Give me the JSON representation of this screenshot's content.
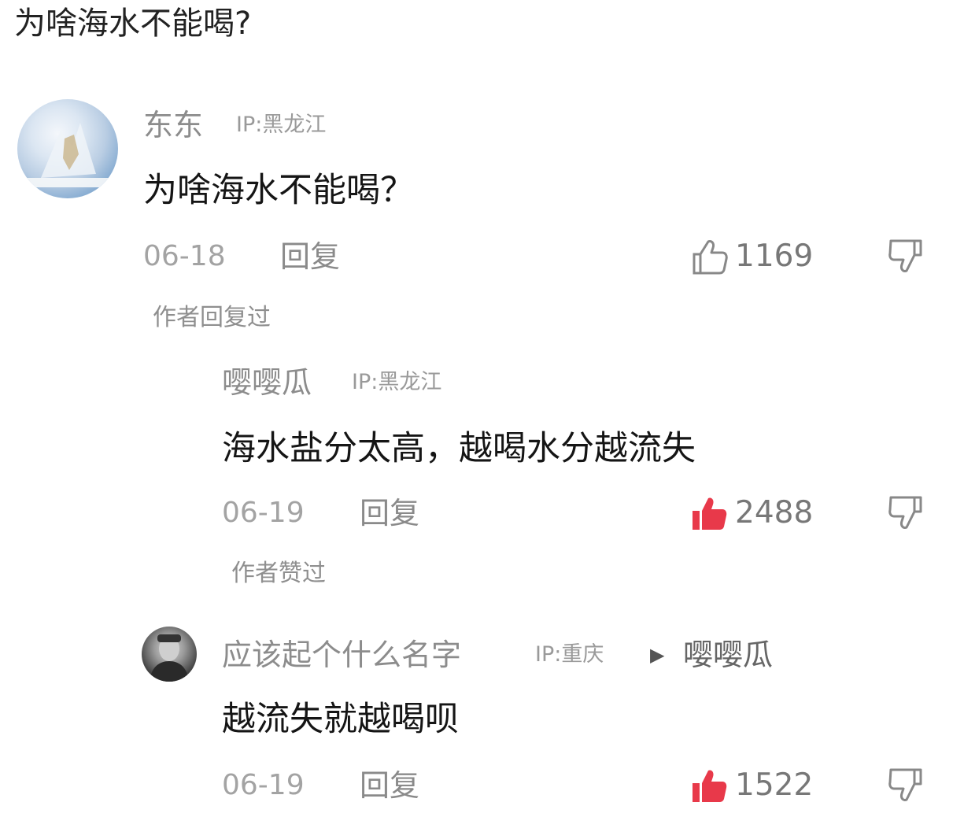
{
  "page": {
    "title": "为啥海水不能喝?"
  },
  "comments": [
    {
      "name": "东东",
      "ip": "IP:黑龙江",
      "text": "为啥海水不能喝？",
      "date": "06-18",
      "reply_label": "回复",
      "likes": "1169",
      "liked": false,
      "note": "作者回复过"
    },
    {
      "name": "嘤嘤瓜",
      "ip": "IP:黑龙江",
      "text": "海水盐分太高，越喝水分越流失",
      "date": "06-19",
      "reply_label": "回复",
      "likes": "2488",
      "liked": true,
      "note": "作者赞过"
    },
    {
      "name": "应该起个什么名字",
      "ip": "IP:重庆",
      "reply_to": "嘤嘤瓜",
      "text": "越流失就越喝呗",
      "date": "06-19",
      "reply_label": "回复",
      "likes": "1522",
      "liked": true
    }
  ],
  "colors": {
    "like_active": "#e8394a",
    "like_inactive": "#888888"
  },
  "icons": {
    "like": "thumbs-up-icon",
    "dislike": "thumbs-down-icon",
    "reply_arrow": "triangle-right-icon"
  }
}
